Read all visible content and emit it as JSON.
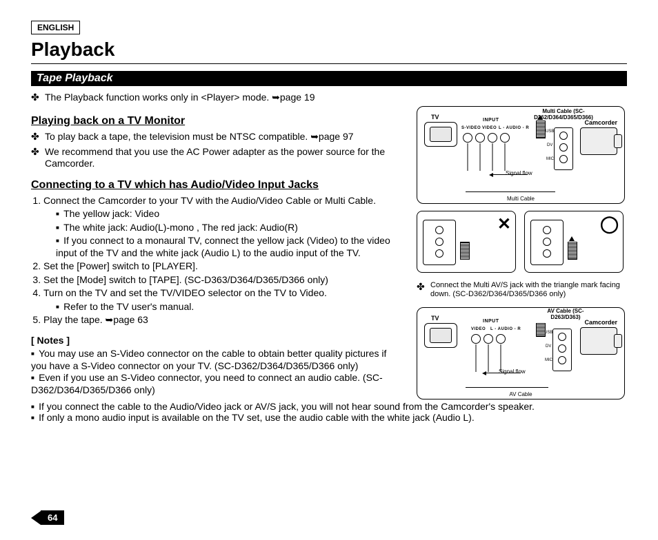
{
  "page": {
    "language": "ENGLISH",
    "title": "Playback",
    "section": "Tape Playback",
    "page_number": "64"
  },
  "intro_line": "The Playback function works only in <Player> mode. ➥page 19",
  "sub1": {
    "heading": "Playing back on a TV Monitor",
    "bullets": [
      "To play back a tape, the television must be NTSC compatible. ➥page 97",
      "We recommend that you use the AC Power adapter as the power source for the Camcorder."
    ]
  },
  "sub2": {
    "heading": "Connecting to a TV which has Audio/Video Input Jacks",
    "steps": [
      "Connect the Camcorder to your TV with the Audio/Video Cable or Multi Cable.",
      "Set the [Power] switch to [PLAYER].",
      "Set the [Mode] switch to [TAPE]. (SC-D363/D364/D365/D366 only)",
      "Turn on the TV and set the TV/VIDEO selector on the TV to Video.",
      "Play the tape. ➥page 63"
    ],
    "step1_sub": [
      "The yellow jack: Video",
      "The white jack: Audio(L)-mono , The red jack: Audio(R)",
      "If you connect to a monaural TV, connect the yellow jack (Video) to the video input of the TV and the white jack (Audio L) to the audio input of the TV."
    ],
    "step4_sub": [
      "Refer to the TV user's manual."
    ]
  },
  "notes": {
    "heading": "[ Notes ]",
    "items": [
      "You may use an S-Video connector on the cable to obtain better quality pictures if you have a S-Video connector on your TV. (SC-D362/D364/D365/D366 only)",
      "Even if you use an S-Video connector, you need to connect an audio cable. (SC-D362/D364/D365/D366 only)",
      "If you connect the cable to the Audio/Video jack or AV/S jack, you will not hear sound from the Camcorder's speaker.",
      "If only a mono audio input is available on the TV set, use the audio cable with the white jack (Audio L)."
    ]
  },
  "diagrams": {
    "top": {
      "tv": "TV",
      "camcorder": "Camcorder",
      "input": "INPUT",
      "svideo": "S-VIDEO",
      "video": "VIDEO",
      "audio": "L - AUDIO - R",
      "cable_title": "Multi Cable (SC-D362/D364/D365/D366)",
      "signal_flow": "Signal flow",
      "cable_label": "Multi Cable",
      "ports": {
        "usb": "USB",
        "dv": "DV",
        "mic": "MIC"
      }
    },
    "connect_note": "Connect the Multi AV/S jack with the triangle mark facing down. (SC-D362/D364/D365/D366 only)",
    "bottom": {
      "tv": "TV",
      "camcorder": "Camcorder",
      "input": "INPUT",
      "video": "VIDEO",
      "audio": "L - AUDIO - R",
      "cable_title": "AV Cable (SC-D263/D363)",
      "signal_flow": "Signal flow",
      "cable_label": "AV Cable",
      "ports": {
        "usb": "USB",
        "dv": "DV",
        "mic": "MIC"
      }
    }
  }
}
